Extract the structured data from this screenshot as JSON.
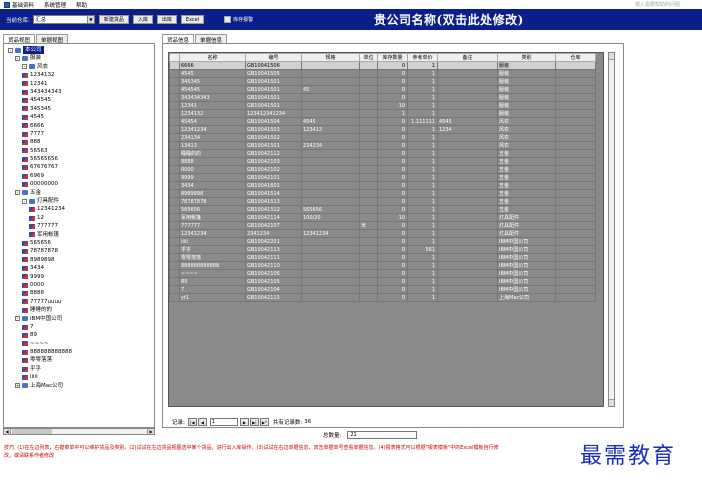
{
  "menubar": {
    "items": [
      {
        "label": "基础资料",
        "icon": "folder-icon"
      },
      {
        "label": "系统管理",
        "icon": ""
      },
      {
        "label": "帮助",
        "icon": ""
      }
    ],
    "hint": "键入需要帮助的问题"
  },
  "toolbar": {
    "current_warehouse_label": "当前仓库:",
    "warehouse_value": "汇总",
    "new_goods": "新建货品",
    "stock_in": "入库",
    "stock_out": "出库",
    "excel": "Excel",
    "inventory_alert": "库存报警",
    "company_name": "贵公司名称(双击此处修改)"
  },
  "left": {
    "tabs": [
      "货品视图",
      "单据视图"
    ],
    "tree": [
      {
        "label": "本公司",
        "level": 0,
        "type": "root",
        "toggle": "-",
        "selected": true
      },
      {
        "label": "服装",
        "level": 1,
        "type": "folder",
        "toggle": "-"
      },
      {
        "label": "风衣",
        "level": 2,
        "type": "folder",
        "toggle": "-"
      },
      {
        "label": "1234132",
        "level": 2,
        "type": "leaf"
      },
      {
        "label": "12341",
        "level": 2,
        "type": "leaf"
      },
      {
        "label": "343434343",
        "level": 2,
        "type": "leaf"
      },
      {
        "label": "454545",
        "level": 2,
        "type": "leaf"
      },
      {
        "label": "345345",
        "level": 2,
        "type": "leaf"
      },
      {
        "label": "4545",
        "level": 2,
        "type": "leaf"
      },
      {
        "label": "6666",
        "level": 2,
        "type": "leaf"
      },
      {
        "label": "7777",
        "level": 2,
        "type": "leaf"
      },
      {
        "label": "888",
        "level": 2,
        "type": "leaf"
      },
      {
        "label": "56563",
        "level": 2,
        "type": "leaf"
      },
      {
        "label": "56565656",
        "level": 2,
        "type": "leaf"
      },
      {
        "label": "67676767",
        "level": 2,
        "type": "leaf"
      },
      {
        "label": "6969",
        "level": 2,
        "type": "leaf"
      },
      {
        "label": "00000000",
        "level": 2,
        "type": "leaf"
      },
      {
        "label": "五金",
        "level": 1,
        "type": "folder",
        "toggle": "-"
      },
      {
        "label": "灯具配件",
        "level": 2,
        "type": "folder",
        "toggle": "-"
      },
      {
        "label": "12341234",
        "level": 3,
        "type": "leaf"
      },
      {
        "label": "12",
        "level": 3,
        "type": "leaf"
      },
      {
        "label": "777777",
        "level": 3,
        "type": "leaf"
      },
      {
        "label": "军用帐篷",
        "level": 3,
        "type": "leaf"
      },
      {
        "label": "565656",
        "level": 2,
        "type": "leaf"
      },
      {
        "label": "78787878",
        "level": 2,
        "type": "leaf"
      },
      {
        "label": "8989898",
        "level": 2,
        "type": "leaf"
      },
      {
        "label": "3434",
        "level": 2,
        "type": "leaf"
      },
      {
        "label": "9999",
        "level": 2,
        "type": "leaf"
      },
      {
        "label": "0000",
        "level": 2,
        "type": "leaf"
      },
      {
        "label": "8888",
        "level": 2,
        "type": "leaf"
      },
      {
        "label": "77777uuuu",
        "level": 2,
        "type": "leaf"
      },
      {
        "label": "睡睡的的",
        "level": 2,
        "type": "leaf"
      },
      {
        "label": "IBM中国公司",
        "level": 1,
        "type": "folder",
        "toggle": "-"
      },
      {
        "label": "7",
        "level": 2,
        "type": "leaf"
      },
      {
        "label": "89",
        "level": 2,
        "type": "leaf"
      },
      {
        "label": "~~~~",
        "level": 2,
        "type": "leaf"
      },
      {
        "label": "888888888888",
        "level": 2,
        "type": "leaf"
      },
      {
        "label": "零零落落",
        "level": 2,
        "type": "leaf"
      },
      {
        "label": "乎乎",
        "level": 2,
        "type": "leaf"
      },
      {
        "label": "iiiii",
        "level": 2,
        "type": "leaf"
      },
      {
        "label": "上海Mac公司",
        "level": 1,
        "type": "folder",
        "toggle": "+"
      }
    ]
  },
  "right": {
    "tabs": [
      "货品信息",
      "单据信息"
    ],
    "columns": [
      "名称",
      "编号",
      "规格",
      "单位",
      "库存数量",
      "参考单价",
      "备注",
      "类别",
      "仓库"
    ],
    "rows": [
      [
        "6666",
        "GB10041506",
        "",
        "",
        "0",
        "1",
        "",
        "服装",
        ""
      ],
      [
        "4545",
        "GB10041505",
        "",
        "",
        "0",
        "1",
        "",
        "服装",
        ""
      ],
      [
        "345345",
        "GB10041501",
        "",
        "",
        "0",
        "1",
        "",
        "服装",
        ""
      ],
      [
        "454545",
        "GB10041501",
        "45",
        "",
        "0",
        "1",
        "",
        "服装",
        ""
      ],
      [
        "343434343",
        "GB10041501",
        "",
        "",
        "0",
        "1",
        "",
        "服装",
        ""
      ],
      [
        "12341",
        "GB10041501",
        "",
        "",
        "10",
        "1",
        "",
        "服装",
        ""
      ],
      [
        "1234132",
        "123412341234",
        "",
        "",
        "1",
        "1",
        "",
        "服装",
        ""
      ],
      [
        "45454",
        "GB10041504",
        "4545",
        "",
        "0",
        "1.111111",
        "4545",
        "风衣",
        ""
      ],
      [
        "12341234",
        "GB10041503",
        "123413",
        "",
        "0",
        "1",
        "1234",
        "风衣",
        ""
      ],
      [
        "234134",
        "GB10041502",
        "",
        "",
        "0",
        "1",
        "",
        "风衣",
        ""
      ],
      [
        "13413",
        "GB10041501",
        "234234",
        "",
        "0",
        "1",
        "",
        "风衣",
        ""
      ],
      [
        "睡睡的的",
        "GB10042112",
        "",
        "",
        "0",
        "1",
        "",
        "五金",
        ""
      ],
      [
        "8888",
        "GB10042103",
        "",
        "",
        "0",
        "1",
        "",
        "五金",
        ""
      ],
      [
        "0000",
        "GB10042102",
        "",
        "",
        "0",
        "1",
        "",
        "五金",
        ""
      ],
      [
        "9999",
        "GB10042101",
        "",
        "",
        "0",
        "1",
        "",
        "五金",
        ""
      ],
      [
        "3434",
        "GB10041601",
        "",
        "",
        "0",
        "1",
        "",
        "五金",
        ""
      ],
      [
        "8989898",
        "GB10041514",
        "",
        "",
        "0",
        "1",
        "",
        "五金",
        ""
      ],
      [
        "78787878",
        "GB10041513",
        "",
        "",
        "0",
        "1",
        "",
        "五金",
        ""
      ],
      [
        "565656",
        "GB10041512",
        "565656",
        "",
        "0",
        "1",
        "",
        "五金",
        ""
      ],
      [
        "军用帐篷",
        "GB10042114",
        "100/20",
        "",
        "10",
        "1",
        "",
        "灯具配件",
        ""
      ],
      [
        "777777",
        "GB10042107",
        "",
        "米",
        "0",
        "1",
        "",
        "灯具配件",
        ""
      ],
      [
        "12341234",
        "2341234",
        "12341234",
        "",
        "0",
        "1",
        "",
        "灯具配件",
        ""
      ],
      [
        "iiiii",
        "GB10042201",
        "",
        "",
        "0",
        "1",
        "",
        "IBM中国公司",
        ""
      ],
      [
        "乎乎",
        "GB10042113",
        "",
        "",
        "0",
        "561",
        "",
        "IBM中国公司",
        ""
      ],
      [
        "零零落落",
        "GB10042111",
        "",
        "",
        "0",
        "1",
        "",
        "IBM中国公司",
        ""
      ],
      [
        "888888888888",
        "GB10042110",
        "",
        "",
        "0",
        "1",
        "",
        "IBM中国公司",
        ""
      ],
      [
        "~~~~",
        "GB10042106",
        "",
        "",
        "0",
        "1",
        "",
        "IBM中国公司",
        ""
      ],
      [
        "89",
        "GB10042105",
        "",
        "",
        "0",
        "1",
        "",
        "IBM中国公司",
        ""
      ],
      [
        "7",
        "GB10042104",
        "",
        "",
        "0",
        "1",
        "",
        "IBM中国公司",
        ""
      ],
      [
        "yt1",
        "GB10042115",
        "",
        "",
        "0",
        "1",
        "",
        "上海Mac公司",
        ""
      ]
    ],
    "record_label": "记录:",
    "record_current": "1",
    "record_count_label": "共有记录数:",
    "record_count": "36",
    "total_label": "总数量:",
    "total_value": "21"
  },
  "tips": "技巧: (1)在左边列表，右键菜单中可以维护货品及类别。(2)试试在左边货品视图选中某个货品，进行出入库操作。(3)试试在右边单据信息，双击单据单号查看单据信息。(4)报表格式可以根据\"报表模板\"中的Excel模板自行修改，或请联系作者修改",
  "brand_watermark": "最需教育",
  "colors": {
    "title_bar": "#0b1f8a",
    "grid_bg": "#8a8a8a",
    "tip_text": "#cc0000",
    "brand": "#1a2db8"
  }
}
